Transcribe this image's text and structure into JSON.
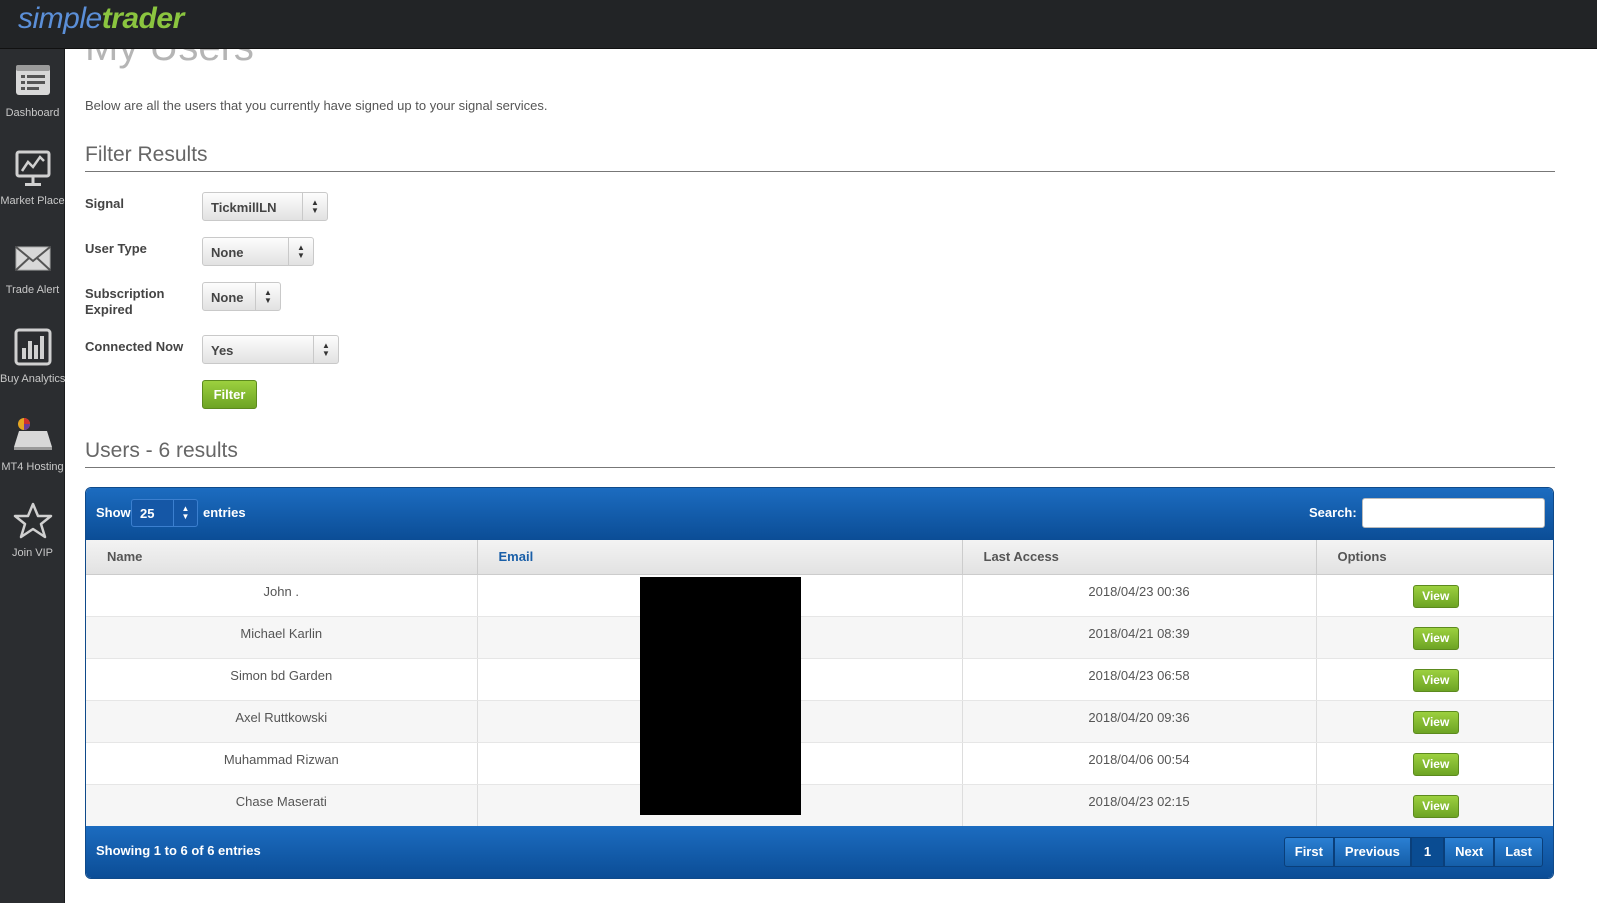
{
  "app": {
    "logo_part1": "simple",
    "logo_part2": "trader"
  },
  "sidebar": {
    "items": [
      {
        "label": "Dashboard",
        "icon": "dashboard-icon"
      },
      {
        "label": "Market Place",
        "icon": "monitor-chart-icon"
      },
      {
        "label": "Trade Alert",
        "icon": "envelope-icon"
      },
      {
        "label": "Buy Analytics",
        "icon": "bar-chart-icon"
      },
      {
        "label": "MT4 Hosting",
        "icon": "server-pie-icon"
      },
      {
        "label": "Join VIP",
        "icon": "star-icon"
      }
    ]
  },
  "page": {
    "title": "My Users",
    "intro": "Below are all the users that you currently have signed up to your signal services."
  },
  "filter": {
    "title": "Filter Results",
    "signal_label": "Signal",
    "signal_value": "TickmillLN",
    "user_type_label": "User Type",
    "user_type_value": "None",
    "sub_expired_label": "Subscription Expired",
    "sub_expired_value": "None",
    "connected_label": "Connected Now",
    "connected_value": "Yes",
    "button": "Filter"
  },
  "users": {
    "title": "Users - 6 results",
    "show_label": "Show",
    "entries_value": "25",
    "entries_label": "entries",
    "search_label": "Search:",
    "columns": [
      "Name",
      "Email",
      "Last Access",
      "Options"
    ],
    "rows": [
      {
        "name": "John .",
        "last_access": "2018/04/23 00:36",
        "action": "View"
      },
      {
        "name": "Michael Karlin",
        "last_access": "2018/04/21 08:39",
        "action": "View"
      },
      {
        "name": "Simon bd Garden",
        "last_access": "2018/04/23 06:58",
        "action": "View"
      },
      {
        "name": "Axel Ruttkowski",
        "last_access": "2018/04/20 09:36",
        "action": "View"
      },
      {
        "name": "Muhammad Rizwan",
        "last_access": "2018/04/06 00:54",
        "action": "View"
      },
      {
        "name": "Chase Maserati",
        "last_access": "2018/04/23 02:15",
        "action": "View"
      }
    ],
    "info": "Showing 1 to 6 of 6 entries",
    "pager": {
      "first": "First",
      "previous": "Previous",
      "current": "1",
      "next": "Next",
      "last": "Last"
    }
  },
  "colors": {
    "accent_green": "#7cb52b",
    "table_blue": "#1560ad",
    "topbar": "#222426"
  }
}
